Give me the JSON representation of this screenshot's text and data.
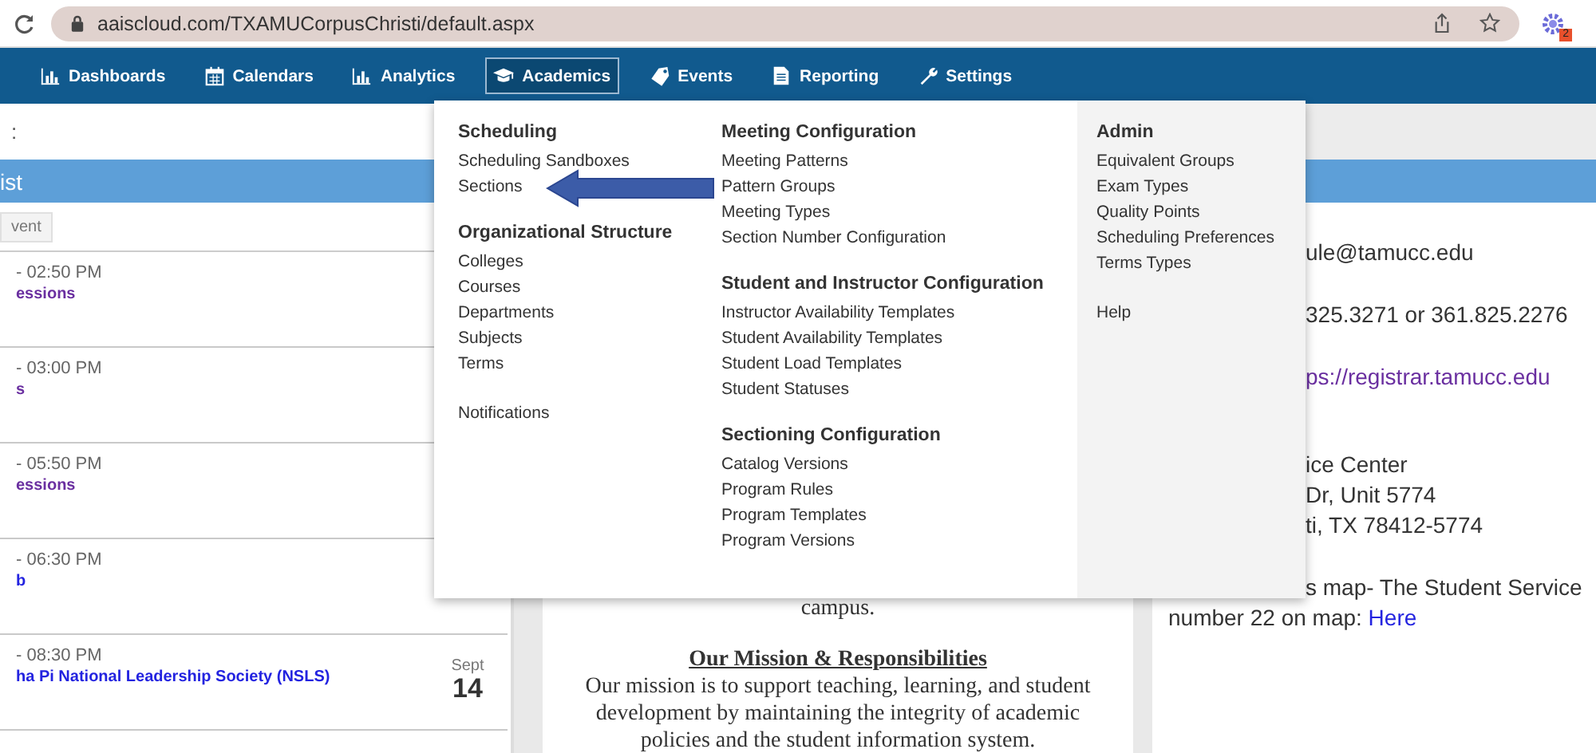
{
  "browser": {
    "url": "aaiscloud.com/TXAMUCorpusChristi/default.aspx",
    "extension_badge": "2"
  },
  "nav": {
    "items": [
      {
        "label": "Dashboards",
        "selected": false
      },
      {
        "label": "Calendars",
        "selected": false
      },
      {
        "label": "Analytics",
        "selected": false
      },
      {
        "label": "Academics",
        "selected": true
      },
      {
        "label": "Events",
        "selected": false
      },
      {
        "label": "Reporting",
        "selected": false
      },
      {
        "label": "Settings",
        "selected": false
      }
    ]
  },
  "left_panel": {
    "toolbar_text": ":",
    "header": "ist",
    "filter_button": "vent",
    "events": [
      {
        "time": "- 02:50 PM",
        "title": "essions",
        "color": "#6a2fa0"
      },
      {
        "time": "- 03:00 PM",
        "title": "s",
        "color": "#6a2fa0"
      },
      {
        "time": "- 05:50 PM",
        "title": "essions",
        "color": "#6a2fa0"
      },
      {
        "time": "- 06:30 PM",
        "title": "b",
        "color": "#2323e0"
      },
      {
        "time": "- 08:30 PM",
        "title": "ha Pi National Leadership Society (NSLS)",
        "color": "#2323e0",
        "date_month": "Sept",
        "date_day": "14"
      }
    ]
  },
  "middle_panel": {
    "lead": "campus.",
    "heading": "Our Mission & Responsibilities",
    "paragraph": "Our mission is to support teaching, learning, and student development by maintaining the integrity of academic policies and the student information system."
  },
  "right_panel": {
    "groups": [
      {
        "lines": [
          {
            "text": "ule@tamucc.edu",
            "kind": "text",
            "covered": true
          }
        ]
      },
      {
        "lines": [
          {
            "text": "325.3271 or 361.825.2276",
            "kind": "text",
            "covered": true
          }
        ]
      },
      {
        "lines": [
          {
            "text": "ps://registrar.tamucc.edu",
            "kind": "link",
            "covered": true
          }
        ]
      },
      {
        "lines": [
          {
            "text": "ice Center",
            "kind": "text",
            "covered": true
          },
          {
            "text": "Dr, Unit 5774",
            "kind": "text",
            "covered": true
          },
          {
            "text": "ti, TX 78412-5774",
            "kind": "text",
            "covered": true
          }
        ]
      },
      {
        "lines": [
          {
            "text": "s map- The Student Service",
            "kind": "text",
            "covered": true
          },
          {
            "text": "number 22 on map:",
            "kind": "text",
            "covered": false,
            "link": "Here"
          }
        ]
      }
    ]
  },
  "academics_menu": {
    "columns": [
      {
        "shaded": false,
        "groups": [
          {
            "heading": "Scheduling",
            "items": [
              {
                "label": "Scheduling Sandboxes"
              },
              {
                "label": "Sections"
              }
            ]
          },
          {
            "heading": "Organizational Structure",
            "items": [
              {
                "label": "Colleges"
              },
              {
                "label": "Courses"
              },
              {
                "label": "Departments"
              },
              {
                "label": "Subjects"
              },
              {
                "label": "Terms"
              }
            ]
          },
          {
            "items": [
              {
                "label": "Notifications"
              }
            ]
          }
        ]
      },
      {
        "shaded": false,
        "groups": [
          {
            "heading": "Meeting Configuration",
            "items": [
              {
                "label": "Meeting Patterns"
              },
              {
                "label": "Pattern Groups"
              },
              {
                "label": "Meeting Types"
              },
              {
                "label": "Section Number Configuration"
              }
            ]
          },
          {
            "heading": "Student and Instructor Configuration",
            "items": [
              {
                "label": "Instructor Availability Templates"
              },
              {
                "label": "Student Availability Templates"
              },
              {
                "label": "Student Load Templates"
              },
              {
                "label": "Student Statuses"
              }
            ]
          },
          {
            "heading": "Sectioning Configuration",
            "items": [
              {
                "label": "Catalog Versions"
              },
              {
                "label": "Program Rules"
              },
              {
                "label": "Program Templates"
              },
              {
                "label": "Program Versions"
              }
            ]
          }
        ]
      },
      {
        "shaded": true,
        "groups": [
          {
            "heading": "Admin",
            "items": [
              {
                "label": "Equivalent Groups"
              },
              {
                "label": "Exam Types"
              },
              {
                "label": "Quality Points"
              },
              {
                "label": "Scheduling Preferences"
              },
              {
                "label": "Terms Types"
              }
            ]
          },
          {
            "items": [
              {
                "label": "Help"
              }
            ]
          }
        ]
      }
    ]
  }
}
